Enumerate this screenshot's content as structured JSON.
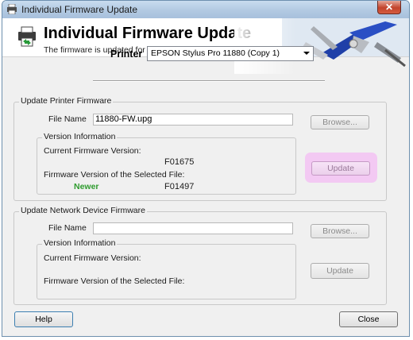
{
  "window": {
    "title": "Individual Firmware Update",
    "close_symbol": "✕",
    "icon": "printer-icon"
  },
  "header": {
    "title": "Individual Firmware Update",
    "subtitle": "The firmware is updated for the selected printer.",
    "icon": "printer-icon",
    "art": "tools-pliers-screwdriver-illustration"
  },
  "printer": {
    "label": "Printer",
    "selected": "EPSON Stylus Pro 11880 (Copy 1)"
  },
  "printer_firmware": {
    "group_title": "Update Printer Firmware",
    "file_name_label": "File Name",
    "file_name_value": "11880-FW.upg",
    "browse_label": "Browse...",
    "version_group_title": "Version Information",
    "current_label": "Current Firmware Version:",
    "current_value": "F01675",
    "selected_label": "Firmware Version of the Selected File:",
    "status": "Newer",
    "selected_value": "F01497",
    "update_label": "Update",
    "status_color": "#2e9b2e",
    "highlight_color": "#f3c9f3"
  },
  "network_firmware": {
    "group_title": "Update Network Device Firmware",
    "file_name_label": "File Name",
    "file_name_value": "",
    "browse_label": "Browse...",
    "version_group_title": "Version Information",
    "current_label": "Current Firmware Version:",
    "selected_label": "Firmware Version of the Selected File:",
    "update_label": "Update"
  },
  "footer": {
    "help_label": "Help",
    "close_label": "Close"
  }
}
